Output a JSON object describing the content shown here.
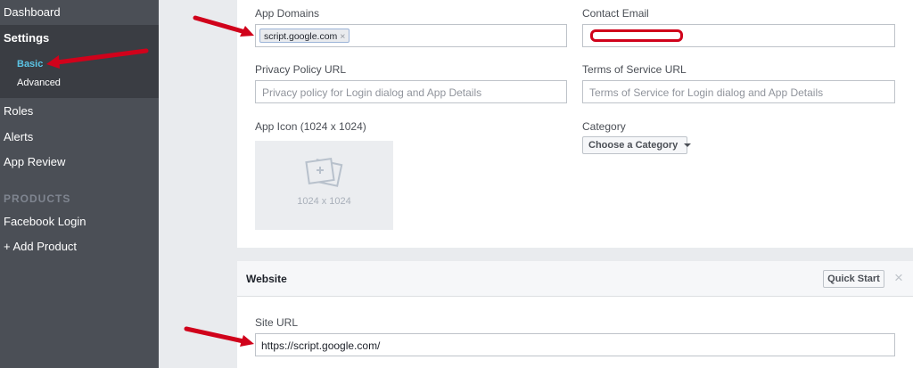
{
  "sidebar": {
    "items": [
      {
        "label": "Dashboard"
      },
      {
        "label": "Settings"
      },
      {
        "label": "Basic"
      },
      {
        "label": "Advanced"
      },
      {
        "label": "Roles"
      },
      {
        "label": "Alerts"
      },
      {
        "label": "App Review"
      }
    ],
    "products_header": "PRODUCTS",
    "products": [
      {
        "label": "Facebook Login"
      },
      {
        "label": "+ Add Product"
      }
    ]
  },
  "basic": {
    "app_domains": {
      "label": "App Domains",
      "tokens": [
        "script.google.com"
      ],
      "remove_glyph": "×"
    },
    "contact_email": {
      "label": "Contact Email",
      "value": ""
    },
    "privacy_policy": {
      "label": "Privacy Policy URL",
      "placeholder": "Privacy policy for Login dialog and App Details"
    },
    "terms_of_service": {
      "label": "Terms of Service URL",
      "placeholder": "Terms of Service for Login dialog and App Details"
    },
    "app_icon": {
      "label": "App Icon (1024 x 1024)",
      "caption": "1024 x 1024"
    },
    "category": {
      "label": "Category",
      "button": "Choose a Category"
    }
  },
  "website": {
    "title": "Website",
    "quick_start": "Quick Start",
    "close_glyph": "×",
    "site_url": {
      "label": "Site URL",
      "value": "https://script.google.com/"
    }
  },
  "colors": {
    "sidebar_bg": "#4b4f56",
    "sidebar_active": "#5bc4e5",
    "annotation_red": "#d0021b"
  }
}
